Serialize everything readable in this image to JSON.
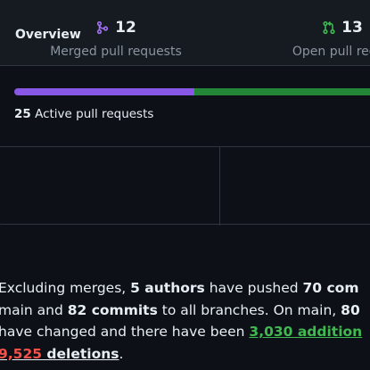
{
  "overview": {
    "title": "Overview",
    "progress": {
      "merged_fraction": 0.48,
      "merged_color": "#8957e5",
      "open_color": "#238636"
    },
    "active": {
      "count": "25",
      "label": "Active pull requests"
    }
  },
  "stats": {
    "merged": {
      "count": "12",
      "label": "Merged pull requests",
      "icon": "git-merge-icon",
      "color": "#a371f7"
    },
    "open": {
      "count": "13",
      "label": "Open pull reque",
      "icon": "git-pull-request-icon",
      "color": "#3fb950"
    }
  },
  "summary": {
    "p1": "Excluding merges, ",
    "authors": "5 authors",
    "p2": " have pushed ",
    "commits_main": "70 com",
    "p3": "main and ",
    "commits_all": "82 commits",
    "p4": " to all branches. On main, ",
    "files": "80",
    "p5": "have changed and there have been ",
    "additions": "3,030 addition",
    "deletions_num": "9,525",
    "deletions_word": " deletions",
    "p6": "."
  }
}
